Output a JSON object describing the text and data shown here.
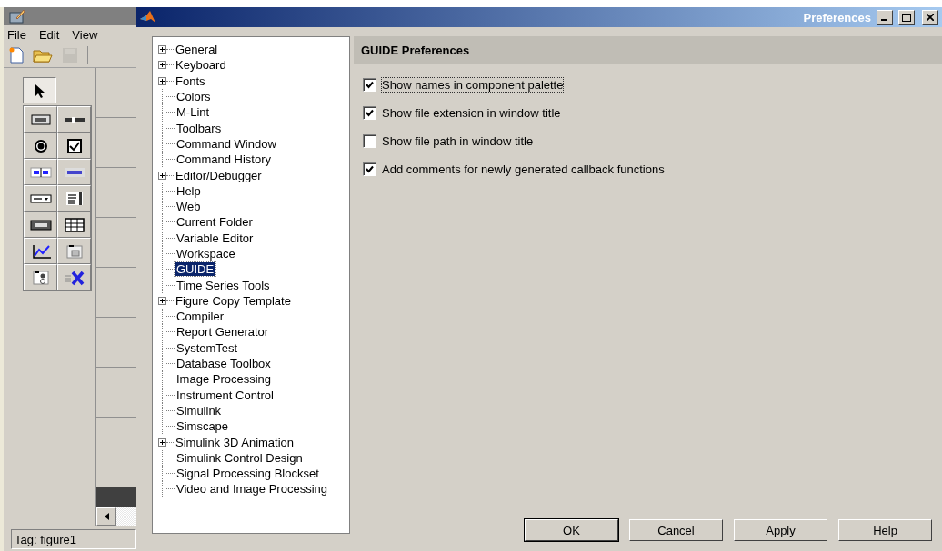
{
  "guide_window": {
    "menu": [
      "File",
      "Edit",
      "View"
    ],
    "toolbar": [
      {
        "kind": "new",
        "disabled": false
      },
      {
        "kind": "open",
        "disabled": false
      },
      {
        "kind": "save",
        "disabled": true
      }
    ],
    "palette": [
      {
        "kind": "pointer",
        "selected": true
      },
      {
        "kind": "push-button",
        "selected": false
      },
      {
        "kind": "slider",
        "selected": false
      },
      {
        "kind": "radio",
        "selected": false
      },
      {
        "kind": "checkbox",
        "selected": false
      },
      {
        "kind": "edit",
        "selected": false
      },
      {
        "kind": "text",
        "selected": false
      },
      {
        "kind": "popup",
        "selected": false
      },
      {
        "kind": "listbox",
        "selected": false
      },
      {
        "kind": "toggle",
        "selected": false
      },
      {
        "kind": "table",
        "selected": false
      },
      {
        "kind": "axes",
        "selected": false
      },
      {
        "kind": "panel",
        "selected": false
      },
      {
        "kind": "button-group",
        "selected": false
      },
      {
        "kind": "activex",
        "selected": false
      }
    ],
    "status": "Tag: figure1"
  },
  "window": {
    "title": "Preferences"
  },
  "tree": [
    {
      "label": "General",
      "kind": "branch",
      "selected": false
    },
    {
      "label": "Keyboard",
      "kind": "branch",
      "selected": false
    },
    {
      "label": "Fonts",
      "kind": "branch",
      "selected": false
    },
    {
      "label": "Colors",
      "kind": "leaf",
      "selected": false
    },
    {
      "label": "M-Lint",
      "kind": "leaf",
      "selected": false
    },
    {
      "label": "Toolbars",
      "kind": "leaf",
      "selected": false
    },
    {
      "label": "Command Window",
      "kind": "leaf",
      "selected": false
    },
    {
      "label": "Command History",
      "kind": "leaf",
      "selected": false
    },
    {
      "label": "Editor/Debugger",
      "kind": "branch",
      "selected": false
    },
    {
      "label": "Help",
      "kind": "leaf",
      "selected": false
    },
    {
      "label": "Web",
      "kind": "leaf",
      "selected": false
    },
    {
      "label": "Current Folder",
      "kind": "leaf",
      "selected": false
    },
    {
      "label": "Variable Editor",
      "kind": "leaf",
      "selected": false
    },
    {
      "label": "Workspace",
      "kind": "leaf",
      "selected": false
    },
    {
      "label": "GUIDE",
      "kind": "leaf",
      "selected": true
    },
    {
      "label": "Time Series Tools",
      "kind": "leaf",
      "selected": false
    },
    {
      "label": "Figure Copy Template",
      "kind": "branch",
      "selected": false
    },
    {
      "label": "Compiler",
      "kind": "leaf",
      "selected": false
    },
    {
      "label": "Report Generator",
      "kind": "leaf",
      "selected": false
    },
    {
      "label": "SystemTest",
      "kind": "leaf",
      "selected": false
    },
    {
      "label": "Database Toolbox",
      "kind": "leaf",
      "selected": false
    },
    {
      "label": "Image Processing",
      "kind": "leaf",
      "selected": false
    },
    {
      "label": "Instrument Control",
      "kind": "leaf",
      "selected": false
    },
    {
      "label": "Simulink",
      "kind": "leaf",
      "selected": false
    },
    {
      "label": "Simscape",
      "kind": "leaf",
      "selected": false
    },
    {
      "label": "Simulink 3D Animation",
      "kind": "branch",
      "selected": false
    },
    {
      "label": "Simulink Control Design",
      "kind": "leaf",
      "selected": false
    },
    {
      "label": "Signal Processing Blockset",
      "kind": "leaf",
      "selected": false
    },
    {
      "label": "Video and Image Processing",
      "kind": "leaf",
      "selected": false
    }
  ],
  "panel": {
    "title": "GUIDE Preferences",
    "options": [
      {
        "label": "Show names in component palette",
        "checked": true,
        "focused": true
      },
      {
        "label": "Show file extension in window title",
        "checked": true,
        "focused": false
      },
      {
        "label": "Show file path in window title",
        "checked": false,
        "focused": false
      },
      {
        "label": "Add comments for newly generated callback functions",
        "checked": true,
        "focused": false
      }
    ]
  },
  "buttons": [
    {
      "label": "OK",
      "default": true
    },
    {
      "label": "Cancel",
      "default": false
    },
    {
      "label": "Apply",
      "default": false
    },
    {
      "label": "Help",
      "default": false
    }
  ]
}
